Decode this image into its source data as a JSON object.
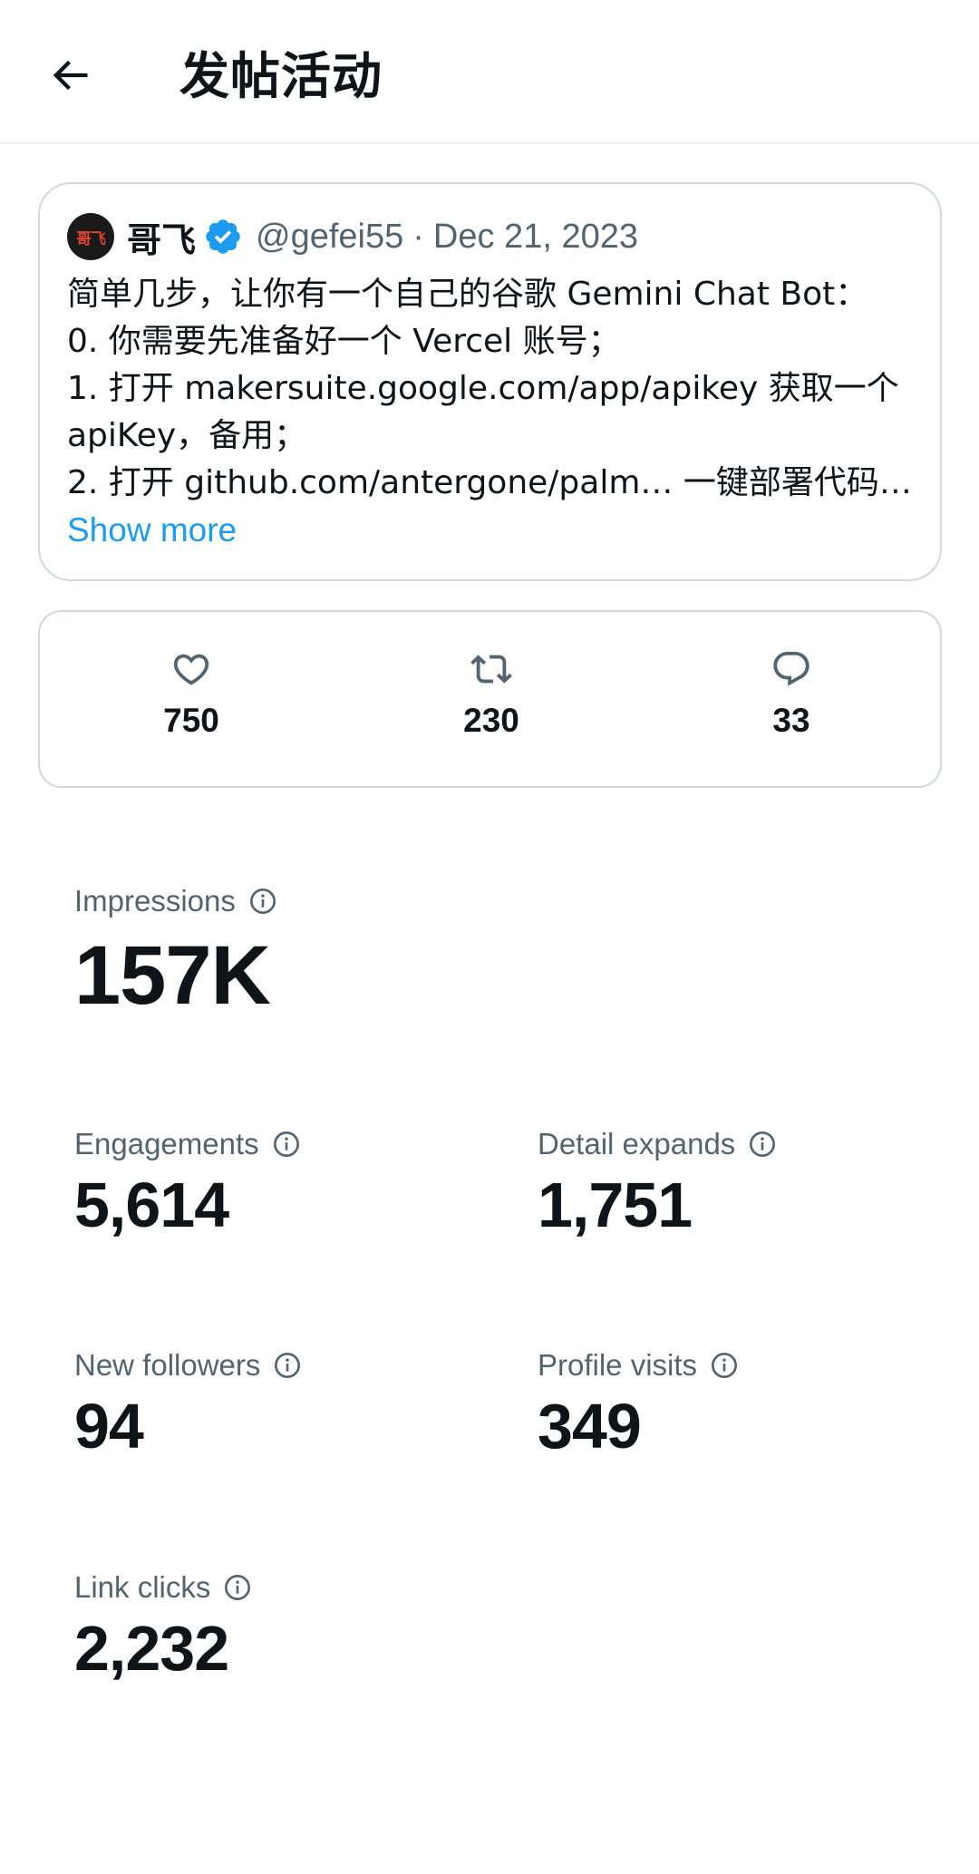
{
  "header": {
    "title": "发帖活动",
    "back_icon": "arrow-left-icon"
  },
  "post": {
    "avatar_text": "哥飞",
    "author_name": "哥飞",
    "verified": true,
    "handle": "@gefei55",
    "separator": "·",
    "date": "Dec 21, 2023",
    "lines": [
      "简单几步，让你有一个自己的谷歌 Gemini Chat Bot：",
      "0. 你需要先准备好一个 Vercel 账号；",
      "1. 打开 makersuite.google.com/app/apikey 获取一个",
      "apiKey，备用；",
      "2. 打开 github.com/antergone/palm… 一键部署代码…"
    ],
    "show_more": "Show more"
  },
  "engagement": {
    "likes": "750",
    "reposts": "230",
    "replies": "33"
  },
  "metrics": {
    "impressions": {
      "label": "Impressions",
      "value": "157K"
    },
    "engagements": {
      "label": "Engagements",
      "value": "5,614"
    },
    "detail_expands": {
      "label": "Detail expands",
      "value": "1,751"
    },
    "new_followers": {
      "label": "New followers",
      "value": "94"
    },
    "profile_visits": {
      "label": "Profile visits",
      "value": "349"
    },
    "link_clicks": {
      "label": "Link clicks",
      "value": "2,232"
    }
  },
  "colors": {
    "text_primary": "#0f1419",
    "text_secondary": "#536471",
    "accent_blue": "#1d9bf0",
    "border": "#cfd9de"
  }
}
